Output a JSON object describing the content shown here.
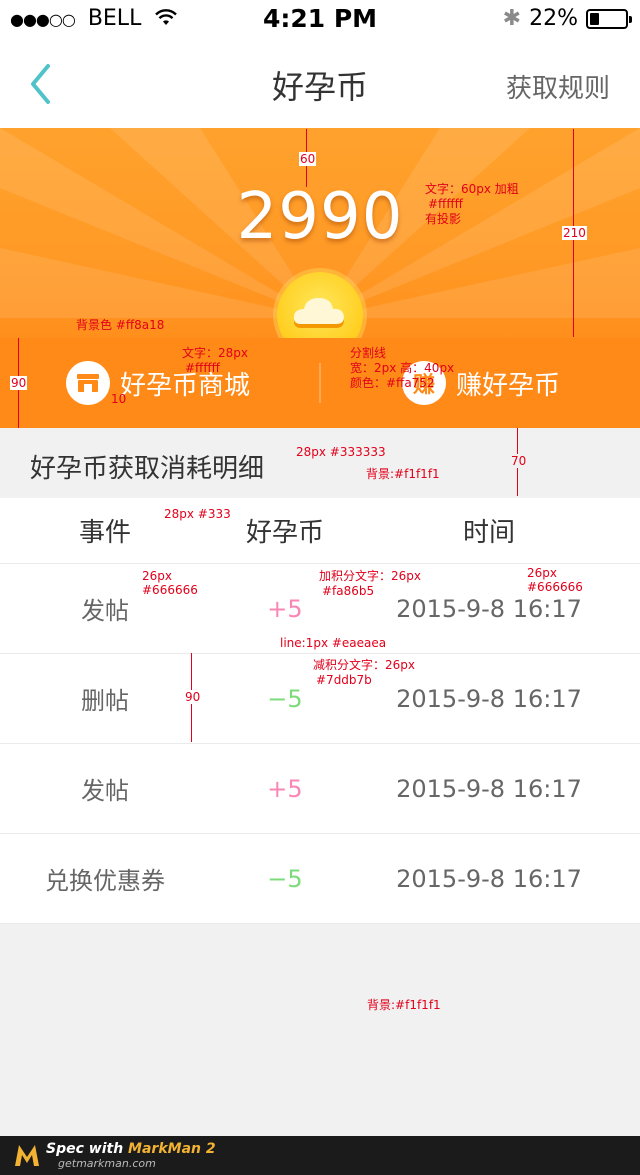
{
  "status_bar": {
    "signal_dots": "●●●○○",
    "carrier": "BELL",
    "time": "4:21 PM",
    "battery": "22%",
    "battery_level": 0.22
  },
  "nav": {
    "title": "好孕币",
    "right_link": "获取规则"
  },
  "banner": {
    "coin_count": "2990"
  },
  "actions": {
    "shop_label": "好孕币商城",
    "earn_label": "赚好孕币",
    "earn_badge": "赚"
  },
  "section": {
    "title": "好孕币获取消耗明细"
  },
  "table": {
    "headers": [
      "事件",
      "好孕币",
      "时间"
    ],
    "rows": [
      {
        "event": "发帖",
        "points": "+5",
        "type": "plus",
        "time": "2015-9-8 16:17"
      },
      {
        "event": "删帖",
        "points": "−5",
        "type": "minus",
        "time": "2015-9-8 16:17"
      },
      {
        "event": "发帖",
        "points": "+5",
        "type": "plus",
        "time": "2015-9-8 16:17"
      },
      {
        "event": "兑换优惠券",
        "points": "−5",
        "type": "minus",
        "time": "2015-9-8 16:17"
      }
    ]
  },
  "annotations": {
    "banner_top": "60",
    "banner_height": "210",
    "count_spec_1": "文字：60px 加粗",
    "count_spec_2": "#ffffff",
    "count_spec_3": "有投影",
    "action_bg": "背景色 #ff8a18",
    "action_height": "90",
    "action_text_1": "文字：28px",
    "action_text_2": "#ffffff",
    "icon_gap": "10",
    "divider_1": "分割线",
    "divider_2": "宽：2px 高：40px",
    "divider_3": "颜色：#ffa752",
    "section_text": "28px #333333",
    "section_bg": "背景:#f1f1f1",
    "section_height": "70",
    "header_text": "28px #333",
    "event_text_1": "26px",
    "event_text_2": "#666666",
    "plus_text_1": "加积分文字：26px",
    "plus_text_2": "#fa86b5",
    "time_text_1": "26px",
    "time_text_2": "#666666",
    "line_spec": "line:1px #eaeaea",
    "minus_text_1": "减积分文字：26px",
    "minus_text_2": "#7ddb7b",
    "row_height": "90",
    "bottom_bg": "背景:#f1f1f1"
  },
  "footer": {
    "text_prefix": "Spec with ",
    "text_brand": "MarkMan 2",
    "site": "getmarkman.com"
  },
  "colors": {
    "accent": "#4fc3c8",
    "banner": "#ff9a26",
    "action_bg": "#ff8a18",
    "divider": "#ffa752",
    "plus": "#fa86b5",
    "minus": "#7ddb7b",
    "text": "#333333",
    "text_secondary": "#666666",
    "line": "#eaeaea",
    "bg": "#f1f1f1"
  }
}
